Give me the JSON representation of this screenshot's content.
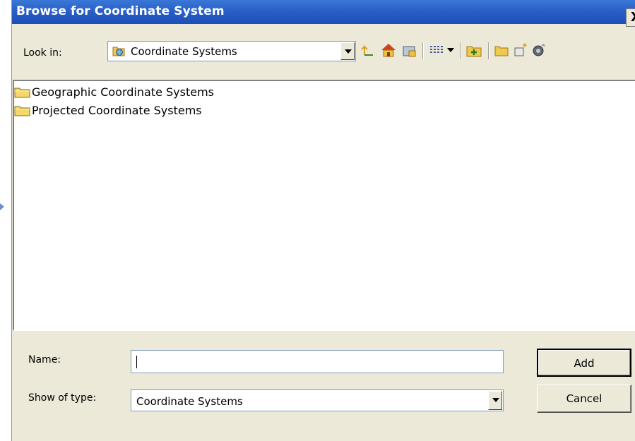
{
  "window": {
    "title": "Browse for Coordinate System",
    "close_glyph": "X"
  },
  "look_in": {
    "label": "Look in:",
    "value": "Coordinate Systems",
    "icon": "globe-folder-icon"
  },
  "toolbar": {
    "buttons": [
      "up-one-level-icon",
      "home-icon",
      "connect-folder-icon",
      "view-menu-icon",
      "new-folder-icon",
      "folder-icon",
      "new-item-icon",
      "catalog-options-icon"
    ]
  },
  "file_list": {
    "items": [
      {
        "name": "Geographic Coordinate Systems",
        "icon": "folder-icon"
      },
      {
        "name": "Projected Coordinate Systems",
        "icon": "folder-icon"
      }
    ]
  },
  "name_field": {
    "label": "Name:",
    "value": ""
  },
  "type_field": {
    "label": "Show of type:",
    "value": "Coordinate Systems"
  },
  "buttons": {
    "add": "Add",
    "cancel": "Cancel"
  },
  "colors": {
    "title_bar": "#2a5fc8",
    "dialog_bg": "#ece9d8",
    "folder_yellow": "#f5d76e"
  }
}
